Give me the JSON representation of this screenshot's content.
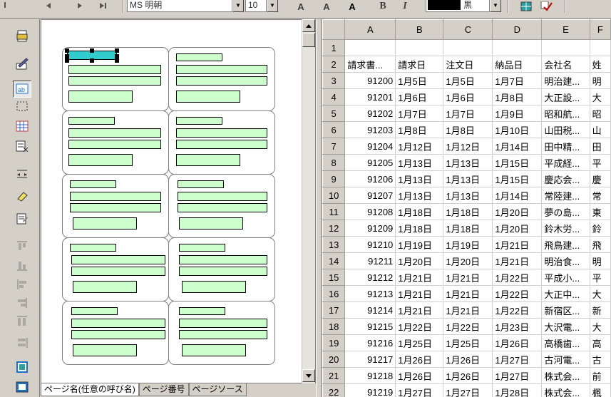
{
  "toolbar": {
    "font_name": "MS 明朝",
    "font_size": "10",
    "bold_a": "A",
    "italic_a": "A",
    "a_label": "A",
    "bold": "B",
    "italic": "I",
    "color_name": "黒"
  },
  "tabs": [
    "ページ名(任意の呼び名)",
    "ページ番号",
    "ページソース"
  ],
  "sheet": {
    "columns": [
      "",
      "A",
      "B",
      "C",
      "D",
      "E",
      "F"
    ],
    "rows": [
      {
        "n": "1",
        "cells": [
          "",
          "",
          "",
          "",
          "",
          ""
        ]
      },
      {
        "n": "2",
        "cells": [
          "請求書...",
          "請求日",
          "注文日",
          "納品日",
          "会社名",
          "姓"
        ]
      },
      {
        "n": "3",
        "cells": [
          "91200",
          "1月5日",
          "1月5日",
          "1月7日",
          "明治建...",
          "明"
        ]
      },
      {
        "n": "4",
        "cells": [
          "91201",
          "1月6日",
          "1月6日",
          "1月8日",
          "大正設...",
          "大"
        ]
      },
      {
        "n": "5",
        "cells": [
          "91202",
          "1月7日",
          "1月7日",
          "1月9日",
          "昭和航...",
          "昭"
        ]
      },
      {
        "n": "6",
        "cells": [
          "91203",
          "1月8日",
          "1月8日",
          "1月10日",
          "山田税...",
          "山"
        ]
      },
      {
        "n": "7",
        "cells": [
          "91204",
          "1月12日",
          "1月12日",
          "1月14日",
          "田中精...",
          "田"
        ]
      },
      {
        "n": "8",
        "cells": [
          "91205",
          "1月13日",
          "1月13日",
          "1月15日",
          "平成経...",
          "平"
        ]
      },
      {
        "n": "9",
        "cells": [
          "91206",
          "1月13日",
          "1月13日",
          "1月15日",
          "慶応会...",
          "慶"
        ]
      },
      {
        "n": "10",
        "cells": [
          "91207",
          "1月13日",
          "1月13日",
          "1月14日",
          "常陸建...",
          "常"
        ]
      },
      {
        "n": "11",
        "cells": [
          "91208",
          "1月18日",
          "1月18日",
          "1月20日",
          "夢の島...",
          "東"
        ]
      },
      {
        "n": "12",
        "cells": [
          "91209",
          "1月18日",
          "1月18日",
          "1月20日",
          "鈴木労...",
          "鈴"
        ]
      },
      {
        "n": "13",
        "cells": [
          "91210",
          "1月19日",
          "1月19日",
          "1月21日",
          "飛鳥建...",
          "飛"
        ]
      },
      {
        "n": "14",
        "cells": [
          "91211",
          "1月20日",
          "1月20日",
          "1月21日",
          "明治食...",
          "明"
        ]
      },
      {
        "n": "15",
        "cells": [
          "91212",
          "1月21日",
          "1月21日",
          "1月22日",
          "平成小...",
          "平"
        ]
      },
      {
        "n": "16",
        "cells": [
          "91213",
          "1月21日",
          "1月21日",
          "1月22日",
          "大正中...",
          "大"
        ]
      },
      {
        "n": "17",
        "cells": [
          "91214",
          "1月21日",
          "1月21日",
          "1月22日",
          "新宿区...",
          "新"
        ]
      },
      {
        "n": "18",
        "cells": [
          "91215",
          "1月22日",
          "1月22日",
          "1月23日",
          "大沢電...",
          "大"
        ]
      },
      {
        "n": "19",
        "cells": [
          "91216",
          "1月25日",
          "1月25日",
          "1月26日",
          "高橋歯...",
          "高"
        ]
      },
      {
        "n": "20",
        "cells": [
          "91217",
          "1月26日",
          "1月26日",
          "1月27日",
          "古河電...",
          "古"
        ]
      },
      {
        "n": "21",
        "cells": [
          "91218",
          "1月26日",
          "1月26日",
          "1月27日",
          "株式会...",
          "前"
        ]
      },
      {
        "n": "22",
        "cells": [
          "91219",
          "1月27日",
          "1月27日",
          "1月28日",
          "株式会...",
          "楓"
        ]
      }
    ]
  },
  "colors": {
    "field_fill": "#ccffcc",
    "selected_field": "#33cccc",
    "chrome": "#d4d0c8"
  }
}
